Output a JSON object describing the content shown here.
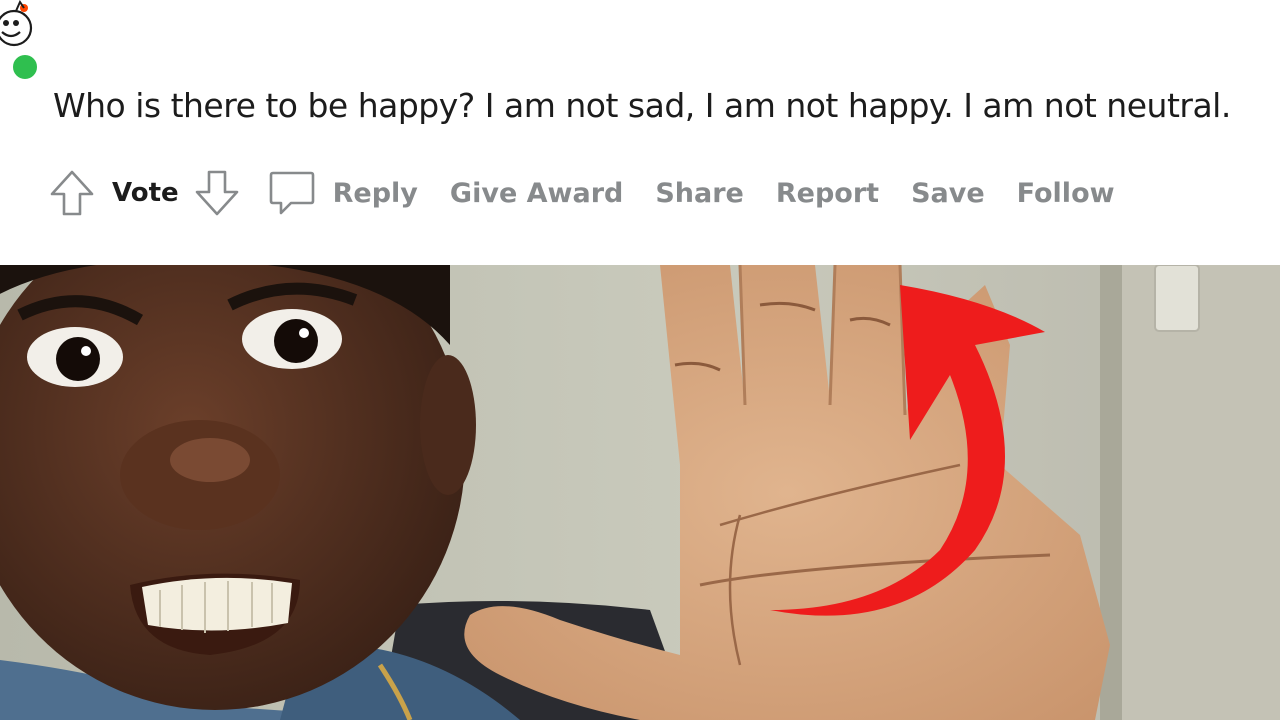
{
  "comment": {
    "avatar_icon": "reddit-snoo-avatar-icon",
    "online_status_color": "#2fbf4f",
    "body": "Who is there to be happy? I am not sad, I am not happy. I am not neutral."
  },
  "actions": {
    "upvote_icon": "arrow-up-icon",
    "vote_label": "Vote",
    "downvote_icon": "arrow-down-icon",
    "reply_icon": "speech-bubble-icon",
    "reply": "Reply",
    "give_award": "Give Award",
    "share": "Share",
    "report": "Report",
    "save": "Save",
    "follow": "Follow"
  },
  "thumbnail": {
    "description_icon": "person-raised-hand-photo",
    "arrow_color": "#ee1c1c"
  }
}
